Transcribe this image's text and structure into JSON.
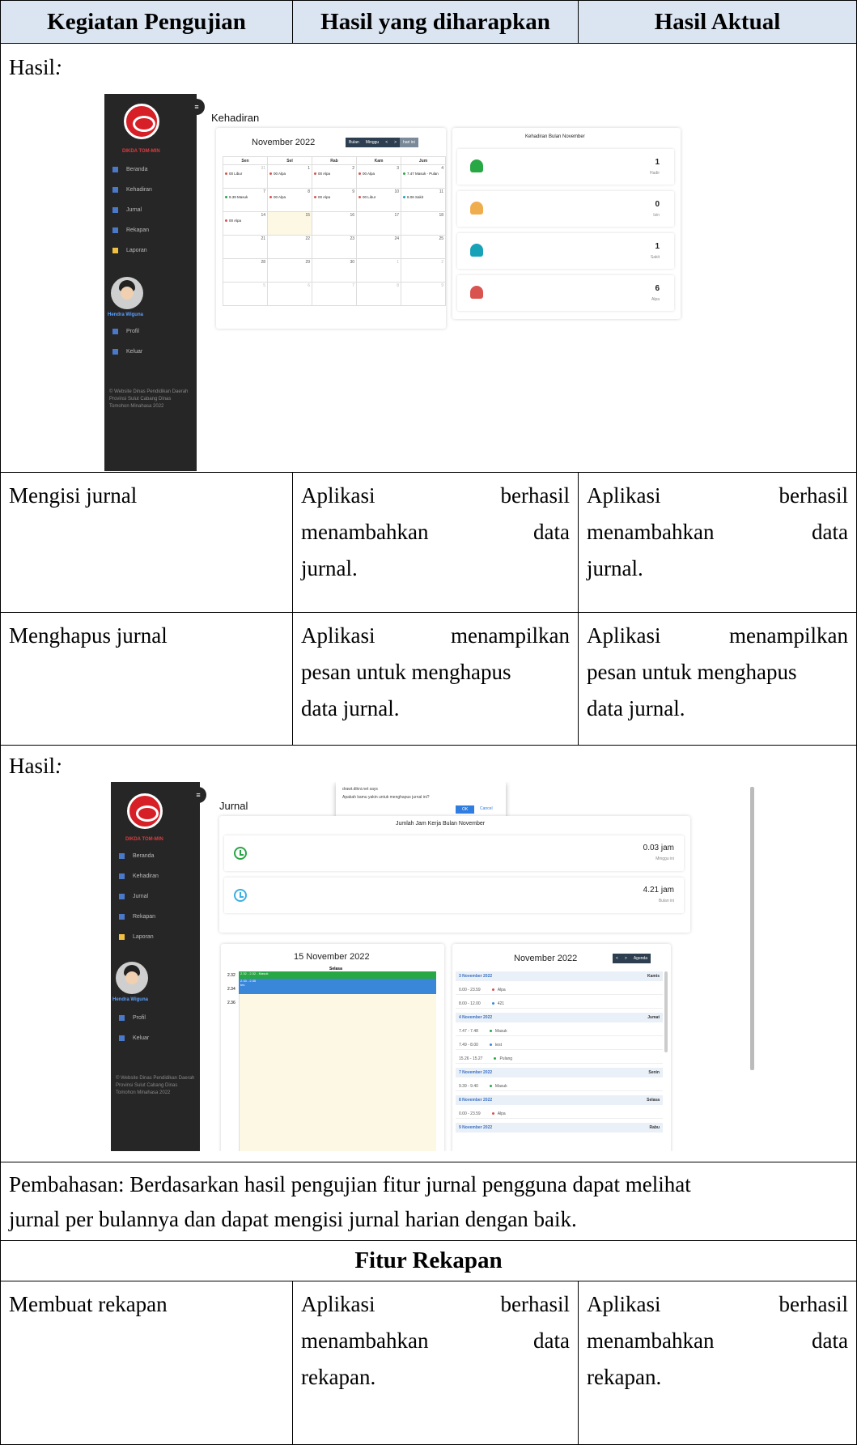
{
  "table": {
    "headers": [
      "Kegiatan Pengujian",
      "Hasil yang diharapkan",
      "Hasil Aktual"
    ],
    "hasil_label": "Hasil",
    "hasil_colon": ":",
    "rows": [
      {
        "kegiatan": "Mengisi jurnal",
        "diharapkan": [
          "Aplikasi",
          "berhasil",
          "menambahkan",
          "data",
          "jurnal."
        ],
        "aktual": [
          "Aplikasi",
          "berhasil",
          "menambahkan",
          "data",
          "jurnal."
        ]
      },
      {
        "kegiatan": "Menghapus jurnal",
        "diharapkan": [
          "Aplikasi",
          "menampilkan",
          "pesan untuk menghapus",
          "data jurnal."
        ],
        "aktual": [
          "Aplikasi",
          "menampilkan",
          "pesan untuk menghapus",
          "data jurnal."
        ]
      }
    ],
    "pembahasan_line1": "Pembahasan: Berdasarkan hasil pengujian fitur jurnal pengguna dapat melihat",
    "pembahasan_line2": "jurnal per bulannya dan dapat mengisi jurnal harian dengan baik.",
    "section_title": "Fitur Rekapan",
    "last_row": {
      "kegiatan": "Membuat rekapan",
      "diharapkan": [
        "Aplikasi",
        "berhasil",
        "menambahkan",
        "data",
        "rekapan."
      ],
      "aktual": [
        "Aplikasi",
        "berhasil",
        "menambahkan",
        "data",
        "rekapan."
      ]
    }
  },
  "sidebar": {
    "brand": "DIKDA TOM-MIN",
    "items": [
      "Beranda",
      "Kehadiran",
      "Jurnal",
      "Rekapan",
      "Laporan"
    ],
    "user": "Hendra Wiguna",
    "profile": "Profil",
    "logout": "Keluar",
    "footer": "© Website Dinas Pendidikan Daerah Provinsi Sulut Cabang Dinas Tomohon Minahasa 2022"
  },
  "shot1": {
    "page_title": "Kehadiran",
    "month": "November 2022",
    "buttons": [
      "Bulan",
      "Minggu",
      "<",
      ">",
      "hari ini"
    ],
    "days": [
      "Sen",
      "Sel",
      "Rab",
      "Kam",
      "Jum"
    ],
    "weeks": [
      [
        {
          "d": "31",
          "m": true,
          "ev": "00 Libur",
          "c": "#d9534f"
        },
        {
          "d": "1",
          "ev": "00 Alpa",
          "c": "#d9534f"
        },
        {
          "d": "2",
          "ev": "00 Alpa",
          "c": "#d9534f"
        },
        {
          "d": "3",
          "ev": "00 Alpa",
          "c": "#d9534f"
        },
        {
          "d": "4",
          "ev": "7.47 Masuk - Pulan",
          "c": "#28a745"
        }
      ],
      [
        {
          "d": "7",
          "ev": "9.39 Masuk",
          "c": "#28a745"
        },
        {
          "d": "8",
          "ev": "00 Alpa",
          "c": "#d9534f"
        },
        {
          "d": "9",
          "ev": "00 Alpa",
          "c": "#d9534f"
        },
        {
          "d": "10",
          "ev": "00 Libur",
          "c": "#d9534f"
        },
        {
          "d": "11",
          "ev": "8.06 Sakit",
          "c": "#17a2b8"
        }
      ],
      [
        {
          "d": "14",
          "ev": "00 Alpa",
          "c": "#d9534f"
        },
        {
          "d": "15",
          "today": true
        },
        {
          "d": "16"
        },
        {
          "d": "17"
        },
        {
          "d": "18"
        }
      ],
      [
        {
          "d": "21"
        },
        {
          "d": "22"
        },
        {
          "d": "23"
        },
        {
          "d": "24"
        },
        {
          "d": "25"
        }
      ],
      [
        {
          "d": "28"
        },
        {
          "d": "29"
        },
        {
          "d": "30"
        },
        {
          "d": "1",
          "m": true
        },
        {
          "d": "2",
          "m": true
        }
      ],
      [
        {
          "d": "5",
          "m": true
        },
        {
          "d": "6",
          "m": true
        },
        {
          "d": "7",
          "m": true
        },
        {
          "d": "8",
          "m": true
        },
        {
          "d": "9",
          "m": true
        }
      ]
    ],
    "stats_title": "Kehadiran Bulan November",
    "stats": [
      {
        "num": "1",
        "label": "Hadir",
        "color": "#28a745"
      },
      {
        "num": "0",
        "label": "Izin",
        "color": "#f0ad4e"
      },
      {
        "num": "1",
        "label": "Sakit",
        "color": "#17a2b8"
      },
      {
        "num": "6",
        "label": "Alpa",
        "color": "#d9534f"
      }
    ]
  },
  "shot2": {
    "page_title": "Jurnal",
    "dialog_site": "drawt.dikni.net says",
    "dialog_msg": "Apakah kamu yakin untuk menghapus jurnal ini?",
    "dialog_ok": "OK",
    "dialog_cancel": "Cancel",
    "hours_title": "Jumlah Jam Kerja Bulan November",
    "week_hours": "0.03 jam",
    "week_label": "Minggu ini",
    "month_hours": "4.21 jam",
    "month_label": "Bulan ini",
    "day_title": "15 November 2022",
    "day_name": "Selasa",
    "times": [
      "2.32",
      "2.34",
      "2.36"
    ],
    "ev1": "2.32 - 2.32 - Masuk",
    "ev2": "2.33 - 2.35",
    "ev2b": "tes",
    "agenda_month": "November 2022",
    "agenda_btn": "Agenda",
    "agenda": [
      {
        "t": "d",
        "a": "3 November 2022",
        "b": "Kamis"
      },
      {
        "t": "e",
        "a": "0.00 - 23.59",
        "b": "Alpa",
        "c": "#d9534f"
      },
      {
        "t": "e",
        "a": "8.00 - 12.00",
        "b": "421",
        "c": "#3a86d9"
      },
      {
        "t": "d",
        "a": "4 November 2022",
        "b": "Jumat"
      },
      {
        "t": "e",
        "a": "7.47 - 7.48",
        "b": "Masuk",
        "c": "#28a745"
      },
      {
        "t": "e",
        "a": "7.49 - 8.00",
        "b": "test",
        "c": "#3a86d9"
      },
      {
        "t": "e",
        "a": "15.26 - 15.27",
        "b": "Pulang",
        "c": "#28a745"
      },
      {
        "t": "d",
        "a": "7 November 2022",
        "b": "Senin"
      },
      {
        "t": "e",
        "a": "9.39 - 9.40",
        "b": "Masuk",
        "c": "#28a745"
      },
      {
        "t": "d",
        "a": "8 November 2022",
        "b": "Selasa"
      },
      {
        "t": "e",
        "a": "0.00 - 23.59",
        "b": "Alpa",
        "c": "#d9534f"
      },
      {
        "t": "d",
        "a": "9 November 2022",
        "b": "Rabu"
      }
    ]
  }
}
